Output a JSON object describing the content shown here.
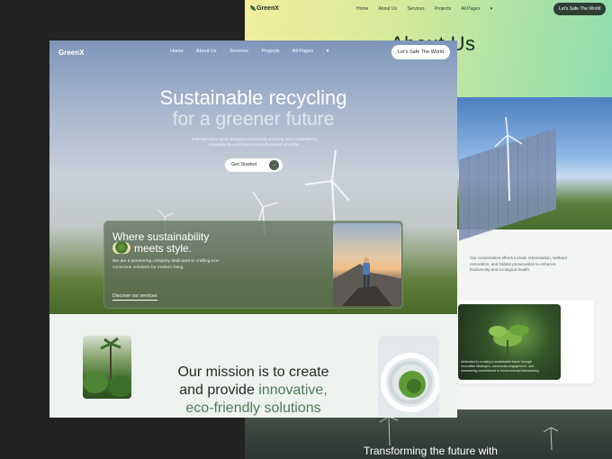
{
  "back": {
    "logo": "GreenX",
    "nav": [
      "Home",
      "About Us",
      "Services",
      "Projects",
      "All Pages"
    ],
    "cta": "Let's Safe The World",
    "heading": "About Us",
    "conservation_text": "Our conservation efforts include reforestation, wetland restoration, and habitat preservation to enhance biodiversity and ecological health.",
    "card_text": "dedicated to creating a sustainable future through innovative strategies, community engagement, and unwavering commitment to environmental stewardship.",
    "bottom_heading": "Transforming the future with"
  },
  "front": {
    "logo": "GreenX",
    "nav": [
      "Home",
      "About Us",
      "Services",
      "Projects",
      "All Pages"
    ],
    "cta": "Let's Safe The World",
    "hero_title_1": "Sustainable recycling",
    "hero_title_2": "for a greener future",
    "hero_sub": "From innovative green designs to sustainable solutions, we're committed to reshaping the world one eco-friendly product at a time.",
    "get_started": "Get Started",
    "card_title_1": "Where sustainability",
    "card_title_2": "meets style.",
    "card_body": "We are a pioneering company dedicated to crafting eco-conscious solutions for modern living.",
    "card_link": "Discover our services",
    "mission_1": "Our mission is to create",
    "mission_2a": "and provide ",
    "mission_2b": "innovative,",
    "mission_3": "eco-friendly solutions"
  },
  "colors": {
    "accent_green": "#4f7a5a",
    "dark": "#232323",
    "back_hero_from": "#f2ee9c",
    "back_hero_to": "#8fdcae"
  }
}
